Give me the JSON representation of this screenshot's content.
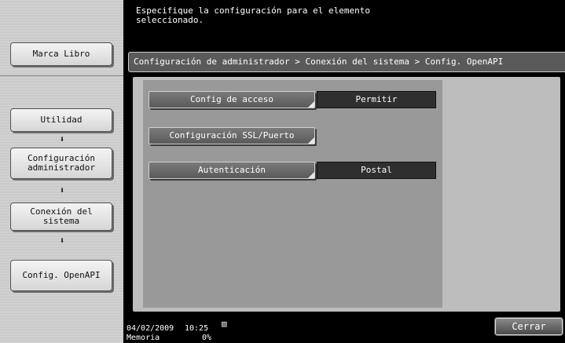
{
  "header": {
    "instruction": "Especifique la configuración para el elemento\nseleccionado."
  },
  "sidebar": {
    "bookmark_label": "Marca Libro",
    "items": [
      {
        "label": "Utilidad"
      },
      {
        "label": "Configuración\nadministrador"
      },
      {
        "label": "Conexión del\nsistema"
      },
      {
        "label": "Config. OpenAPI"
      }
    ],
    "arrow": "⬇"
  },
  "breadcrumb": {
    "text": "Configuración de administrador > Conexión del sistema > Config. OpenAPI"
  },
  "settings": [
    {
      "label": "Config de acceso",
      "value": "Permitir"
    },
    {
      "label": "Configuración SSL/Puerto",
      "value": ""
    },
    {
      "label": "Autenticación",
      "value": "Postal"
    }
  ],
  "footer": {
    "date": "04/02/2009",
    "time": "10:25",
    "memory_label": "Memoria",
    "memory_value": "0%",
    "icon": "network-status-icon",
    "close_label": "Cerrar"
  }
}
